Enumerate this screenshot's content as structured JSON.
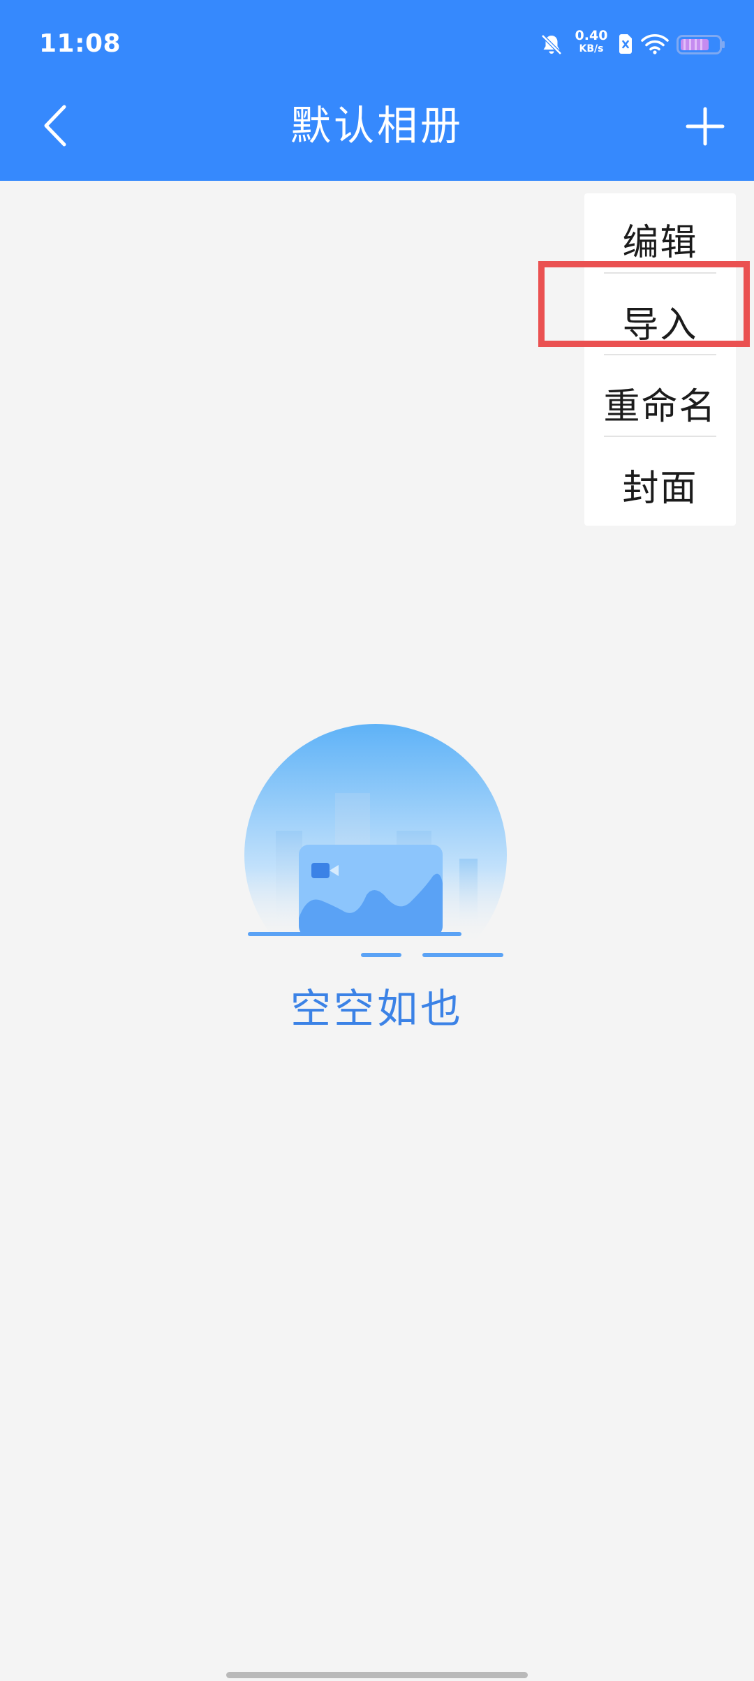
{
  "status_bar": {
    "time": "11:08",
    "net_speed_value": "0.40",
    "net_speed_unit": "KB/s",
    "icons": [
      "bell-mute-icon",
      "sim-icon",
      "wifi-icon",
      "battery-icon"
    ]
  },
  "header": {
    "title": "默认相册",
    "back_icon": "chevron-left-icon",
    "add_icon": "plus-icon",
    "background_color": "#3689fd"
  },
  "menu": {
    "items": [
      {
        "label": "编辑"
      },
      {
        "label": "导入"
      },
      {
        "label": "重命名"
      },
      {
        "label": "封面"
      }
    ],
    "highlighted_index": 1,
    "highlight_color": "#ea5151"
  },
  "empty_state": {
    "message": "空空如也",
    "illustration": "empty-album-illustration",
    "text_color": "#3b82e6"
  }
}
